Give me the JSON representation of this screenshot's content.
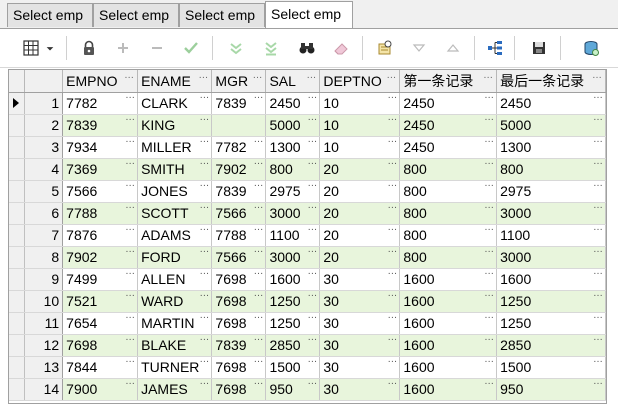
{
  "tabs": [
    {
      "label": "Select emp",
      "active": false
    },
    {
      "label": "Select emp",
      "active": false
    },
    {
      "label": "Select emp",
      "active": false
    },
    {
      "label": "Select emp",
      "active": true
    }
  ],
  "toolbar": {
    "icons": [
      "grid-icon",
      "dropdown-arrow-icon",
      "lock-icon",
      "plus-icon",
      "minus-icon",
      "check-icon",
      "down-arrow-icon",
      "double-down-arrow-icon",
      "binoculars-icon",
      "eraser-icon",
      "query-icon",
      "triangle-down-icon",
      "triangle-up-icon",
      "tree-icon",
      "save-icon",
      "database-icon"
    ]
  },
  "grid": {
    "columns": [
      "EMPNO",
      "ENAME",
      "MGR",
      "SAL",
      "DEPTNO",
      "第一条记录",
      "最后一条记录"
    ],
    "rows": [
      {
        "n": "1",
        "EMPNO": "7782",
        "ENAME": "CLARK",
        "MGR": "7839",
        "SAL": "2450",
        "DEPTNO": "10",
        "first": "2450",
        "last": "2450"
      },
      {
        "n": "2",
        "EMPNO": "7839",
        "ENAME": "KING",
        "MGR": "",
        "SAL": "5000",
        "DEPTNO": "10",
        "first": "2450",
        "last": "5000"
      },
      {
        "n": "3",
        "EMPNO": "7934",
        "ENAME": "MILLER",
        "MGR": "7782",
        "SAL": "1300",
        "DEPTNO": "10",
        "first": "2450",
        "last": "1300"
      },
      {
        "n": "4",
        "EMPNO": "7369",
        "ENAME": "SMITH",
        "MGR": "7902",
        "SAL": "800",
        "DEPTNO": "20",
        "first": "800",
        "last": "800"
      },
      {
        "n": "5",
        "EMPNO": "7566",
        "ENAME": "JONES",
        "MGR": "7839",
        "SAL": "2975",
        "DEPTNO": "20",
        "first": "800",
        "last": "2975"
      },
      {
        "n": "6",
        "EMPNO": "7788",
        "ENAME": "SCOTT",
        "MGR": "7566",
        "SAL": "3000",
        "DEPTNO": "20",
        "first": "800",
        "last": "3000"
      },
      {
        "n": "7",
        "EMPNO": "7876",
        "ENAME": "ADAMS",
        "MGR": "7788",
        "SAL": "1100",
        "DEPTNO": "20",
        "first": "800",
        "last": "1100"
      },
      {
        "n": "8",
        "EMPNO": "7902",
        "ENAME": "FORD",
        "MGR": "7566",
        "SAL": "3000",
        "DEPTNO": "20",
        "first": "800",
        "last": "3000"
      },
      {
        "n": "9",
        "EMPNO": "7499",
        "ENAME": "ALLEN",
        "MGR": "7698",
        "SAL": "1600",
        "DEPTNO": "30",
        "first": "1600",
        "last": "1600"
      },
      {
        "n": "10",
        "EMPNO": "7521",
        "ENAME": "WARD",
        "MGR": "7698",
        "SAL": "1250",
        "DEPTNO": "30",
        "first": "1600",
        "last": "1250"
      },
      {
        "n": "11",
        "EMPNO": "7654",
        "ENAME": "MARTIN",
        "MGR": "7698",
        "SAL": "1250",
        "DEPTNO": "30",
        "first": "1600",
        "last": "1250"
      },
      {
        "n": "12",
        "EMPNO": "7698",
        "ENAME": "BLAKE",
        "MGR": "7839",
        "SAL": "2850",
        "DEPTNO": "30",
        "first": "1600",
        "last": "2850"
      },
      {
        "n": "13",
        "EMPNO": "7844",
        "ENAME": "TURNER",
        "MGR": "7698",
        "SAL": "1500",
        "DEPTNO": "30",
        "first": "1600",
        "last": "1500"
      },
      {
        "n": "14",
        "EMPNO": "7900",
        "ENAME": "JAMES",
        "MGR": "7698",
        "SAL": "950",
        "DEPTNO": "30",
        "first": "1600",
        "last": "950"
      }
    ],
    "current_row": 1,
    "alt_row_color": "#e8f5dc"
  }
}
